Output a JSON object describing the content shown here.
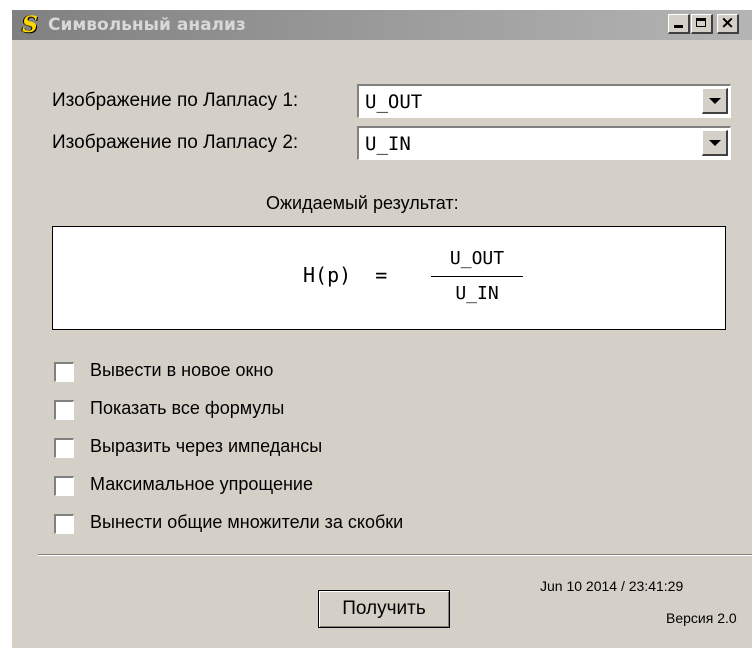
{
  "window": {
    "title": "Символьный анализ",
    "icon": "S",
    "controls": {
      "minimize": "minimize-icon",
      "maximize": "maximize-icon",
      "close": "×"
    }
  },
  "fields": [
    {
      "label": "Изображение по Лапласу 1:",
      "value": "U_OUT"
    },
    {
      "label": "Изображение по Лапласу 2:",
      "value": "U_IN"
    }
  ],
  "expected": {
    "label": "Ожидаемый результат:",
    "lhs": "H(p)",
    "equals": "=",
    "numerator": "U_OUT",
    "denominator": "U_IN"
  },
  "options": [
    {
      "label": "Вывести в новое окно",
      "checked": false
    },
    {
      "label": "Показать все формулы",
      "checked": false
    },
    {
      "label": "Выразить через импедансы",
      "checked": false
    },
    {
      "label": "Максимальное упрощение",
      "checked": false
    },
    {
      "label": "Вынести общие множители за скобки",
      "checked": false
    }
  ],
  "actions": {
    "get_label": "Получить"
  },
  "footer": {
    "date": "Jun 10 2014 / 23:41:29",
    "version": "Версия 2.0"
  },
  "colors": {
    "face": "#d4d0c8",
    "title_gradient_start": "#808080",
    "title_gradient_end": "#b5b5b5",
    "icon": "#ffd800"
  }
}
